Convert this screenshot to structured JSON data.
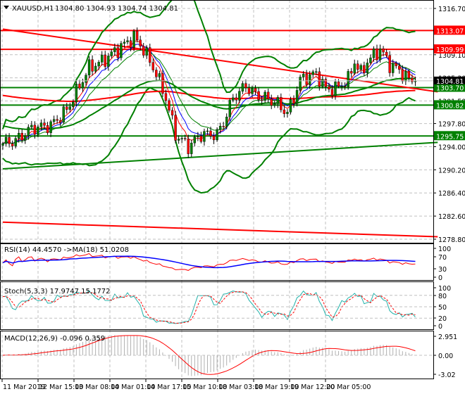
{
  "header": {
    "symbol": "XAUUSD,H1",
    "ohlc": "1304.80 1304.93 1304.74 1304.81"
  },
  "colors": {
    "bull": "#008000",
    "bear": "#ff0000",
    "grid": "#c0c0c0",
    "level_red": "#ff0000",
    "level_green": "#008000"
  },
  "chart_data": [
    {
      "type": "candlestick",
      "title": "XAUUSD,H1",
      "ylim": [
        1278.8,
        1316.7
      ],
      "price_ticks": [
        "1316.70",
        "1309.10",
        "1305.30",
        "1301.50",
        "1297.80",
        "1294.00",
        "1290.20",
        "1286.40",
        "1282.60",
        "1278.80"
      ],
      "time_labels": [
        "11 Mar 2019",
        "12 Mar 15:00",
        "13 Mar 08:00",
        "14 Mar 01:00",
        "14 Mar 17:00",
        "15 Mar 10:00",
        "18 Mar 03:00",
        "18 Mar 19:00",
        "19 Mar 12:00",
        "20 Mar 05:00"
      ],
      "bar_count": 130,
      "close_keypoints": [
        [
          0,
          1294.5
        ],
        [
          4,
          1295
        ],
        [
          9,
          1297
        ],
        [
          15,
          1297.5
        ],
        [
          20,
          1300
        ],
        [
          22,
          1302
        ],
        [
          27,
          1307
        ],
        [
          31,
          1308
        ],
        [
          36,
          1310
        ],
        [
          41,
          1312
        ],
        [
          44,
          1310
        ],
        [
          48,
          1306
        ],
        [
          51,
          1302
        ],
        [
          54,
          1296
        ],
        [
          58,
          1294
        ],
        [
          62,
          1296
        ],
        [
          67,
          1296
        ],
        [
          69,
          1298
        ],
        [
          72,
          1302
        ],
        [
          76,
          1304
        ],
        [
          79,
          1302.5
        ],
        [
          82,
          1302
        ],
        [
          86,
          1301
        ],
        [
          89,
          1299.5
        ],
        [
          91,
          1302
        ],
        [
          93,
          1305
        ],
        [
          98,
          1306
        ],
        [
          101,
          1303.5
        ],
        [
          104,
          1303.5
        ],
        [
          108,
          1305
        ],
        [
          110,
          1308
        ],
        [
          112,
          1306
        ],
        [
          114,
          1308
        ],
        [
          118,
          1310
        ],
        [
          121,
          1307.5
        ],
        [
          124,
          1306.5
        ],
        [
          127,
          1305
        ],
        [
          129,
          1304.81
        ]
      ],
      "current_price": {
        "label": "1304.81",
        "value": 1304.81
      },
      "levels": [
        {
          "label": "1313.07",
          "value": 1313.07,
          "color": "red"
        },
        {
          "label": "1309.99",
          "value": 1309.99,
          "color": "red"
        },
        {
          "label": "1303.70",
          "value": 1303.7,
          "color": "green"
        },
        {
          "label": "1300.82",
          "value": 1300.82,
          "color": "green"
        },
        {
          "label": "1295.75",
          "value": 1295.75,
          "color": "green"
        }
      ],
      "trendlines": [
        {
          "color": "red",
          "from": [
            0,
            1313.3
          ],
          "to": [
            136,
            1303.0
          ]
        },
        {
          "color": "red",
          "from": [
            0,
            1281.6
          ],
          "to": [
            136,
            1279.2
          ]
        },
        {
          "color": "green",
          "from": [
            0,
            1290.35
          ],
          "to": [
            136,
            1294.7
          ]
        }
      ]
    },
    {
      "type": "line",
      "title": "RSI(14) 44.4570  ->MA(18) 51.0208",
      "ylim": [
        0,
        100
      ],
      "ticks": [
        "100",
        "70",
        "30",
        "0"
      ]
    },
    {
      "type": "line",
      "title": "Stoch(5,3,3) 17.9747 15.1772",
      "ylim": [
        0,
        100
      ],
      "ticks": [
        "100",
        "80",
        "50",
        "20",
        "0"
      ]
    },
    {
      "type": "bar",
      "title": "MACD(12,26,9) -0.096 0.359",
      "ylim": [
        -3.02,
        2.951
      ],
      "ticks": [
        "2.951",
        "0.00",
        "-3.02"
      ]
    }
  ]
}
